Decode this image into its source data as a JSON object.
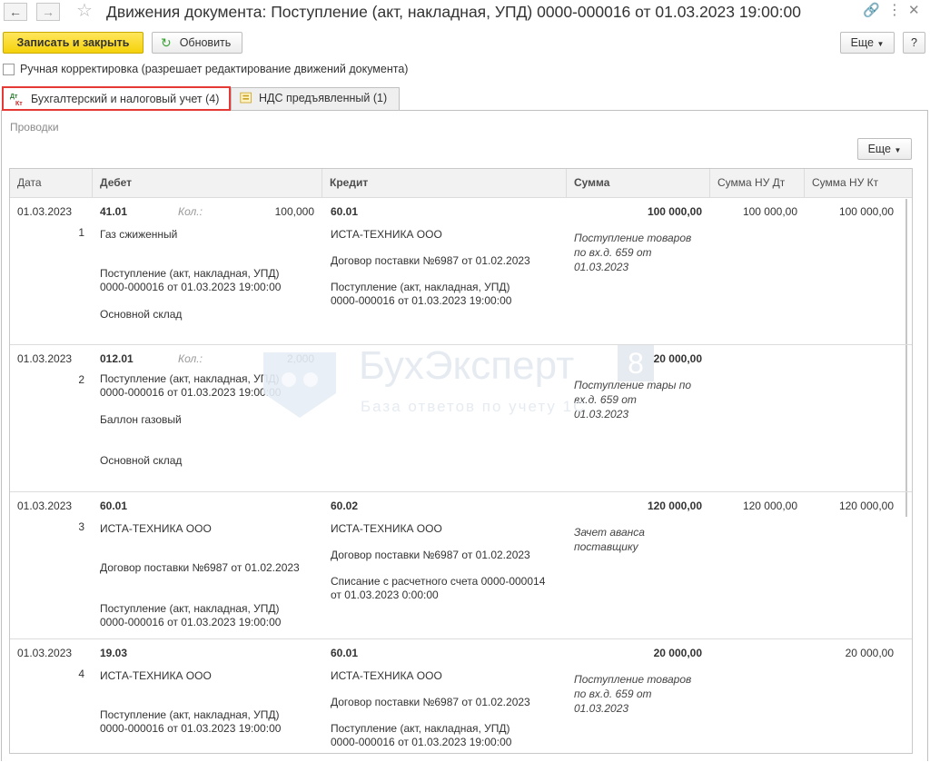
{
  "window": {
    "title": "Движения документа: Поступление (акт, накладная, УПД) 0000-000016 от 01.03.2023 19:00:00"
  },
  "toolbar": {
    "save_close": "Записать и закрыть",
    "refresh": "Обновить",
    "more": "Еще",
    "help": "?"
  },
  "manual_correction": {
    "label": "Ручная корректировка (разрешает редактирование движений документа)",
    "checked": false
  },
  "tabs": [
    {
      "label": "Бухгалтерский и налоговый учет (4)",
      "icon": "dt-kt-icon",
      "active": true
    },
    {
      "label": "НДС предъявленный (1)",
      "icon": "register-icon",
      "active": false
    }
  ],
  "section": {
    "label": "Проводки",
    "more": "Еще"
  },
  "columns": [
    "Дата",
    "Дебет",
    "Кредит",
    "Сумма",
    "Сумма НУ Дт",
    "Сумма НУ Кт"
  ],
  "rows": [
    {
      "date": "01.03.2023",
      "num": "1",
      "debit_account": "41.01",
      "qty_label": "Кол.:",
      "qty": "100,000",
      "debit_lines": [
        "Газ сжиженный",
        "Поступление (акт, накладная, УПД)\n0000-000016 от 01.03.2023 19:00:00",
        "Основной склад"
      ],
      "credit_account": "60.01",
      "credit_lines": [
        "ИСТА-ТЕХНИКА ООО",
        "Договор поставки №6987 от 01.02.2023",
        "Поступление (акт, накладная, УПД)\n0000-000016 от 01.03.2023 19:00:00"
      ],
      "sum": "100 000,00",
      "content": "Поступление товаров\nпо вх.д. 659 от\n01.03.2023",
      "nu_dt": "100 000,00",
      "nu_kt": "100 000,00"
    },
    {
      "date": "01.03.2023",
      "num": "2",
      "debit_account": "012.01",
      "qty_label": "Кол.:",
      "qty": "2,000",
      "debit_lines": [
        "Поступление (акт, накладная, УПД)\n0000-000016 от 01.03.2023 19:00:00",
        "Баллон газовый",
        "Основной склад"
      ],
      "credit_account": "",
      "credit_lines": [],
      "sum": "20 000,00",
      "content": "Поступление тары по\nвх.д. 659 от\n01.03.2023",
      "nu_dt": "",
      "nu_kt": ""
    },
    {
      "date": "01.03.2023",
      "num": "3",
      "debit_account": "60.01",
      "qty_label": "",
      "qty": "",
      "debit_lines": [
        "ИСТА-ТЕХНИКА ООО",
        "Договор поставки №6987 от 01.02.2023",
        "Поступление (акт, накладная, УПД)\n0000-000016 от 01.03.2023 19:00:00"
      ],
      "credit_account": "60.02",
      "credit_lines": [
        "ИСТА-ТЕХНИКА ООО",
        "Договор поставки №6987 от 01.02.2023",
        "Списание с расчетного счета 0000-000014\nот 01.03.2023 0:00:00"
      ],
      "sum": "120 000,00",
      "content": "Зачет аванса\nпоставщику",
      "nu_dt": "120 000,00",
      "nu_kt": "120 000,00"
    },
    {
      "date": "01.03.2023",
      "num": "4",
      "debit_account": "19.03",
      "qty_label": "",
      "qty": "",
      "debit_lines": [
        "ИСТА-ТЕХНИКА ООО",
        "Поступление (акт, накладная, УПД)\n0000-000016 от 01.03.2023 19:00:00"
      ],
      "credit_account": "60.01",
      "credit_lines": [
        "ИСТА-ТЕХНИКА ООО",
        "Договор поставки №6987 от 01.02.2023",
        "Поступление (акт, накладная, УПД)\n0000-000016 от 01.03.2023 19:00:00"
      ],
      "sum": "20 000,00",
      "content": "Поступление товаров\nпо вх.д. 659 от\n01.03.2023",
      "nu_dt": "",
      "nu_kt": "20 000,00"
    }
  ],
  "watermark": {
    "brand": "БухЭксперт",
    "digit": "8",
    "tagline": "База ответов по учету 1С"
  },
  "colors": {
    "primary_button": "#f5d20a",
    "active_tab_border": "#e53935",
    "refresh_icon": "#3aa335"
  }
}
